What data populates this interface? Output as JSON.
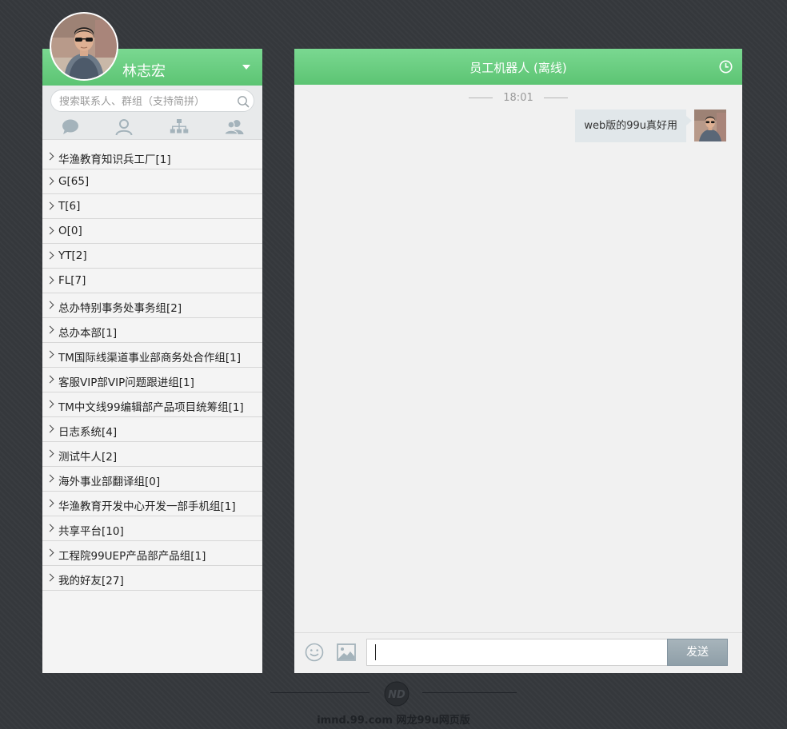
{
  "user": {
    "name": "林志宏"
  },
  "search": {
    "placeholder": "搜索联系人、群组（支持简拼）"
  },
  "nav_tabs": [
    {
      "name": "chat",
      "icon": "chat-bubble-icon"
    },
    {
      "name": "contacts",
      "icon": "person-icon"
    },
    {
      "name": "organization",
      "icon": "org-tree-icon"
    },
    {
      "name": "groups",
      "icon": "group-icon"
    }
  ],
  "groups": [
    "华渔教育知识兵工厂[1]",
    "G[65]",
    "T[6]",
    "O[0]",
    "YT[2]",
    "FL[7]",
    "总办特别事务处事务组[2]",
    "总办本部[1]",
    "TM国际线渠道事业部商务处合作组[1]",
    "客服VIP部VIP问题跟进组[1]",
    "TM中文线99编辑部产品项目统筹组[1]",
    "日志系统[4]",
    "测试牛人[2]",
    "海外事业部翻译组[0]",
    "华渔教育开发中心开发一部手机组[1]",
    "共享平台[10]",
    "工程院99UEP产品部产品组[1]",
    "我的好友[27]"
  ],
  "chat": {
    "title": "员工机器人 (离线)",
    "time": "18:01",
    "messages": [
      {
        "text": "web版的99u真好用",
        "sender": "self"
      }
    ],
    "input_value": "",
    "send_label": "发送"
  },
  "footer": {
    "text": "imnd.99.com 网龙99u网页版"
  },
  "colors": {
    "header_green": "#6cce84",
    "background": "#35383c",
    "send_button": "#97a7b0"
  }
}
